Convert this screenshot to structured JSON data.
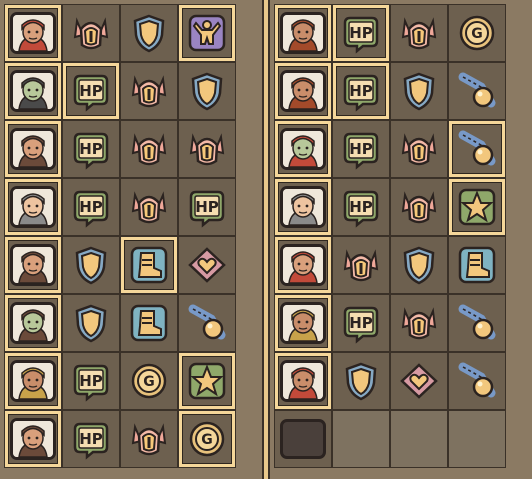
{
  "colors": {
    "accent": "#f5d79a",
    "bg": "#8b7a63",
    "tile": "#6d604f"
  },
  "left_team": [
    {
      "hero": "green-hood-warrior",
      "items": [
        {
          "icon": "horned-helmet"
        },
        {
          "icon": "shield"
        },
        {
          "icon": "strength-figure",
          "selected": true
        }
      ]
    },
    {
      "hero": "visored-knight",
      "items": [
        {
          "icon": "hp-potion",
          "label": "HP",
          "selected": true
        },
        {
          "icon": "horned-helmet"
        },
        {
          "icon": "shield"
        }
      ]
    },
    {
      "hero": "red-beard-dwarf",
      "items": [
        {
          "icon": "hp-potion",
          "label": "HP"
        },
        {
          "icon": "horned-helmet"
        },
        {
          "icon": "horned-helmet"
        }
      ]
    },
    {
      "hero": "helmet-dwarf",
      "items": [
        {
          "icon": "hp-potion",
          "label": "HP"
        },
        {
          "icon": "horned-helmet"
        },
        {
          "icon": "hp-potion",
          "label": "HP"
        }
      ]
    },
    {
      "hero": "hooded-ranger",
      "items": [
        {
          "icon": "shield"
        },
        {
          "icon": "boot",
          "selected": true
        },
        {
          "icon": "heart-gem"
        }
      ]
    },
    {
      "hero": "cross-helm-knight",
      "items": [
        {
          "icon": "shield"
        },
        {
          "icon": "boot"
        },
        {
          "icon": "comet"
        }
      ]
    },
    {
      "hero": "red-hair-brawler",
      "items": [
        {
          "icon": "hp-potion",
          "label": "HP"
        },
        {
          "icon": "gold-coin"
        },
        {
          "icon": "star",
          "selected": true
        }
      ]
    },
    {
      "hero": "orc-warrior",
      "items": [
        {
          "icon": "hp-potion",
          "label": "HP"
        },
        {
          "icon": "horned-helmet"
        },
        {
          "icon": "gold-coin",
          "selected": true
        }
      ]
    }
  ],
  "right_team": [
    {
      "hero": "bearded-old-dwarf",
      "items": [
        {
          "icon": "hp-potion",
          "label": "HP",
          "selected": true
        },
        {
          "icon": "horned-helmet"
        },
        {
          "icon": "gold-coin"
        }
      ]
    },
    {
      "hero": "bull-horn-knight",
      "items": [
        {
          "icon": "hp-potion",
          "label": "HP",
          "selected": true
        },
        {
          "icon": "shield"
        },
        {
          "icon": "comet"
        }
      ]
    },
    {
      "hero": "long-beard-elder",
      "items": [
        {
          "icon": "hp-potion",
          "label": "HP"
        },
        {
          "icon": "horned-helmet"
        },
        {
          "icon": "comet",
          "selected": true
        }
      ]
    },
    {
      "hero": "red-hair-maiden",
      "items": [
        {
          "icon": "hp-potion",
          "label": "HP"
        },
        {
          "icon": "horned-helmet"
        },
        {
          "icon": "star",
          "selected": true
        }
      ]
    },
    {
      "hero": "blonde-hooded-mage",
      "items": [
        {
          "icon": "horned-helmet"
        },
        {
          "icon": "shield"
        },
        {
          "icon": "boot"
        }
      ]
    },
    {
      "hero": "bandana-fighter",
      "items": [
        {
          "icon": "hp-potion",
          "label": "HP"
        },
        {
          "icon": "horned-helmet"
        },
        {
          "icon": "comet"
        }
      ]
    },
    {
      "hero": "gunner-hero",
      "items": [
        {
          "icon": "shield"
        },
        {
          "icon": "heart-gem"
        },
        {
          "icon": "comet"
        }
      ]
    },
    {
      "hero": "empty",
      "items": []
    }
  ]
}
